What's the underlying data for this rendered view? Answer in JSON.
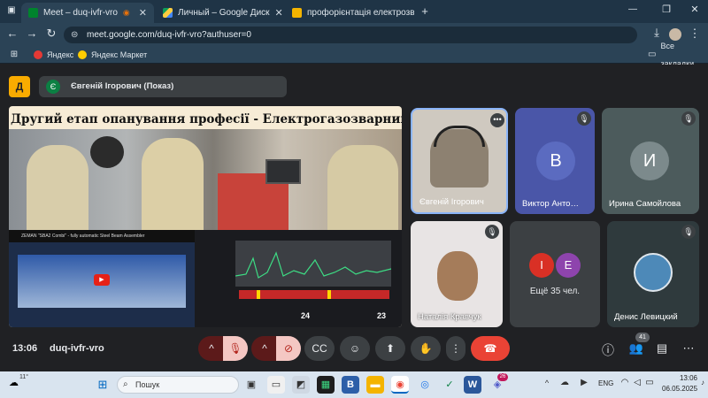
{
  "tabs": [
    {
      "title": "Meet – duq-ivfr-vro",
      "active": true
    },
    {
      "title": "Личный – Google Диск",
      "active": false
    },
    {
      "title": "профорієнтація електрозварн",
      "active": false
    }
  ],
  "address": {
    "url": "meet.google.com/duq-ivfr-vro?authuser=0"
  },
  "bookmarks": {
    "items": [
      "Яндекс",
      "Яндекс Маркет"
    ],
    "all": "Все закладки"
  },
  "meet": {
    "logo": "Д",
    "presenter_avatar": "Є",
    "presenting": "Євгеній Ігорович (Показ)",
    "slide_title": "Другий етап опанування професії - Електрогазозварник",
    "video_caption": "ZEMAN \"SBA2 Combi\" - fully automatic Steel Beam Assembler",
    "gauge_left": "24",
    "gauge_right": "23",
    "participants": [
      {
        "name": "Євгеній Ігорович",
        "initial": "",
        "color": "#cfc9c0"
      },
      {
        "name": "Виктор Анто…",
        "initial": "В",
        "color": "#5b6bc0"
      },
      {
        "name": "Ирина Самойлова",
        "initial": "И",
        "color": "#7c8a8c"
      },
      {
        "name": "Наталія Кравчук",
        "initial": "",
        "color": "#e8e4e4"
      },
      {
        "name": "Денис Левицкий",
        "initial": "",
        "color": "#4d89b8"
      }
    ],
    "others": {
      "label": "Ещё 35 чел.",
      "avatars": [
        "І",
        "Е"
      ],
      "colors": [
        "#d93025",
        "#8e44ad"
      ]
    },
    "time": "13:06",
    "code": "duq-ivfr-vro",
    "people_count": "41"
  },
  "taskbar": {
    "weather": "11°",
    "search_placeholder": "Пошук",
    "lang": "ENG",
    "clock_time": "13:06",
    "clock_date": "06.05.2025",
    "badge": "26"
  }
}
